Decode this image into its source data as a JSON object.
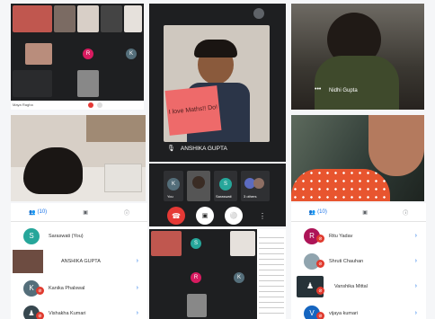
{
  "top_left": {
    "initials": [
      "R",
      "K"
    ],
    "names": [
      "Maya Ragha"
    ]
  },
  "top_center": {
    "sign_text": "I love Maths!! Do!",
    "caption": "ANSHIKA GUPTA",
    "thumbs": [
      {
        "initial": "K",
        "label": "You"
      },
      {
        "initial": "",
        "label": ""
      },
      {
        "initial": "S",
        "label": "Saraswati"
      },
      {
        "initial": "",
        "label": "3 others"
      }
    ]
  },
  "top_right": {
    "caption": "Nidhi Gupta"
  },
  "bottom_left": {
    "tabs": [
      {
        "icon": "people-icon",
        "label": "(10)"
      },
      {
        "icon": "chat-icon",
        "label": ""
      },
      {
        "icon": "info-icon",
        "label": ""
      }
    ],
    "participants": [
      {
        "initial": "S",
        "name": "Saraswati (You)",
        "color": "#26a69a"
      },
      {
        "initial": "",
        "name": "ANSHIKA GUPTA",
        "color": "#8d6e63"
      },
      {
        "initial": "K",
        "name": "Kanika Phalswal",
        "color": "#546e7a"
      },
      {
        "initial": "",
        "name": "Vishakha Kumari",
        "color": "#37474f"
      }
    ]
  },
  "bottom_center": {
    "initials": [
      "S",
      "R",
      "K"
    ]
  },
  "bottom_right": {
    "tabs": [
      {
        "icon": "people-icon",
        "label": "(10)"
      },
      {
        "icon": "chat-icon",
        "label": ""
      },
      {
        "icon": "info-icon",
        "label": ""
      }
    ],
    "participants": [
      {
        "initial": "R",
        "name": "Ritu Yadav",
        "color": "#ad1457"
      },
      {
        "initial": "",
        "name": "Shruti Chauhan",
        "color": "#90a4ae"
      },
      {
        "initial": "",
        "name": "Vanshika Mittal",
        "color": "#263238"
      },
      {
        "initial": "V",
        "name": "vijaya kumari",
        "color": "#1565c0"
      }
    ]
  },
  "colors": {
    "accent": "#1a73e8",
    "hangup": "#e53935",
    "meet_dark": "#1e1f21"
  }
}
